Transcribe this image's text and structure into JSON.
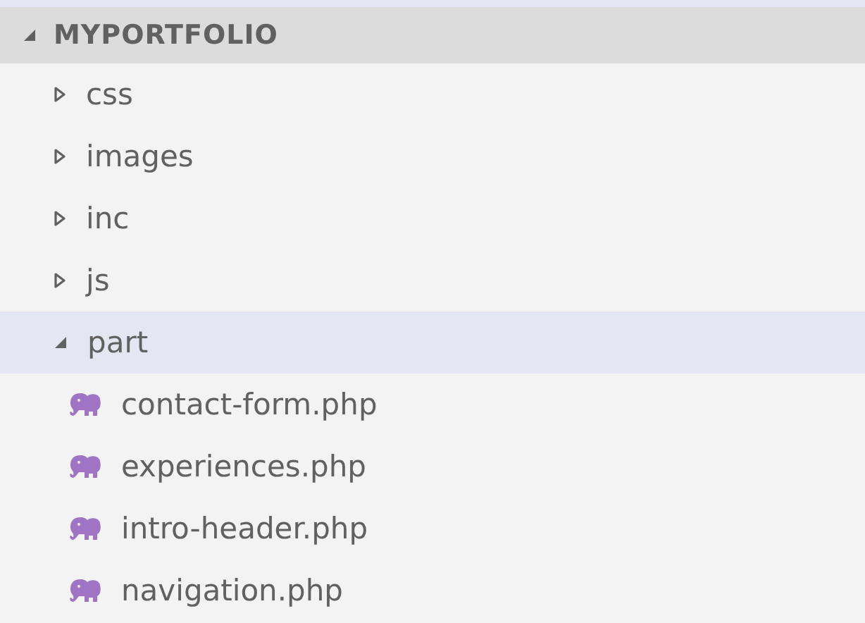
{
  "explorer": {
    "title": "MYPORTFOLIO",
    "expanded": true,
    "items": [
      {
        "kind": "folder",
        "name": "css",
        "expanded": false,
        "selected": false
      },
      {
        "kind": "folder",
        "name": "images",
        "expanded": false,
        "selected": false
      },
      {
        "kind": "folder",
        "name": "inc",
        "expanded": false,
        "selected": false
      },
      {
        "kind": "folder",
        "name": "js",
        "expanded": false,
        "selected": false
      },
      {
        "kind": "folder",
        "name": "part",
        "expanded": true,
        "selected": true,
        "children": [
          {
            "kind": "file",
            "name": "contact-form.php",
            "selected": false
          },
          {
            "kind": "file",
            "name": "experiences.php",
            "selected": false
          },
          {
            "kind": "file",
            "name": "intro-header.php",
            "selected": false
          },
          {
            "kind": "file",
            "name": "navigation.php",
            "selected": false
          }
        ]
      }
    ]
  }
}
